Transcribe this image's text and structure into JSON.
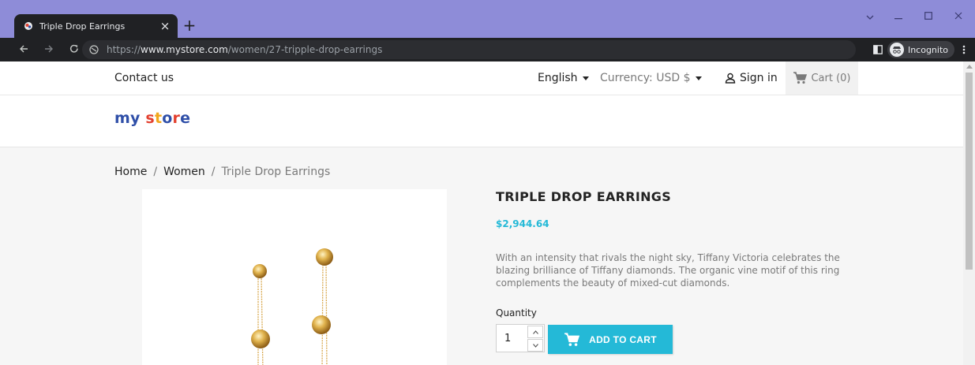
{
  "browser": {
    "tab_title": "Triple Drop Earrings",
    "tab_close": "×",
    "new_tab": "+",
    "url_scheme": "https://",
    "url_host": "www.mystore.com",
    "url_path": "/women/27-tripple-drop-earrings",
    "incognito_label": "Incognito",
    "window_controls": [
      "chevron-down-icon",
      "minimize-icon",
      "maximize-icon",
      "close-icon"
    ],
    "frame_color": "#8e8cd8"
  },
  "topnav": {
    "contact": "Contact us",
    "language": "English",
    "currency": "Currency: USD $",
    "sign_in": "Sign in",
    "cart": "Cart (0)"
  },
  "logo": {
    "letters": [
      {
        "char": "m",
        "color": "#2f4fa8"
      },
      {
        "char": "y",
        "color": "#2f4fa8"
      },
      {
        "char": " ",
        "color": "#2f4fa8"
      },
      {
        "char": "s",
        "color": "#e3402f"
      },
      {
        "char": "t",
        "color": "#f2a71b"
      },
      {
        "char": "o",
        "color": "#2f4fa8"
      },
      {
        "char": "r",
        "color": "#e3402f"
      },
      {
        "char": "e",
        "color": "#2f4fa8"
      }
    ]
  },
  "breadcrumb": {
    "home": "Home",
    "sep": "/",
    "category": "Women",
    "current": "Triple Drop Earrings"
  },
  "product": {
    "title": "TRIPLE DROP EARRINGS",
    "price": "$2,944.64",
    "description": "With an intensity that rivals the night sky, Tiffany Victoria celebrates the blazing brilliance of Tiffany diamonds. The organic vine motif of this ring complements the beauty of mixed-cut diamonds.",
    "quantity_label": "Quantity",
    "quantity_value": "1",
    "add_to_cart": "ADD TO CART",
    "accent_color": "#24b9d7"
  }
}
